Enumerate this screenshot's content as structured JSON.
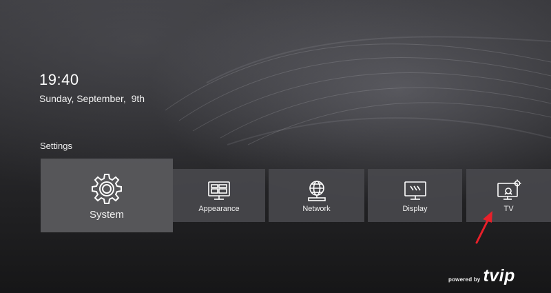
{
  "home": {
    "time": "19:40",
    "date": "Sunday, September,  9th"
  },
  "settings": {
    "title": "Settings",
    "tiles": [
      {
        "label": "System",
        "icon": "gear-icon",
        "selected": true
      },
      {
        "label": "Appearance",
        "icon": "monitor-layout-icon",
        "selected": false
      },
      {
        "label": "Network",
        "icon": "globe-network-icon",
        "selected": false
      },
      {
        "label": "Display",
        "icon": "display-icon",
        "selected": false
      },
      {
        "label": "TV",
        "icon": "tv-settings-icon",
        "selected": false
      }
    ]
  },
  "annotation": {
    "arrow_color": "#e8202a"
  },
  "branding": {
    "powered_by": "powered by",
    "logo": "tvip"
  }
}
